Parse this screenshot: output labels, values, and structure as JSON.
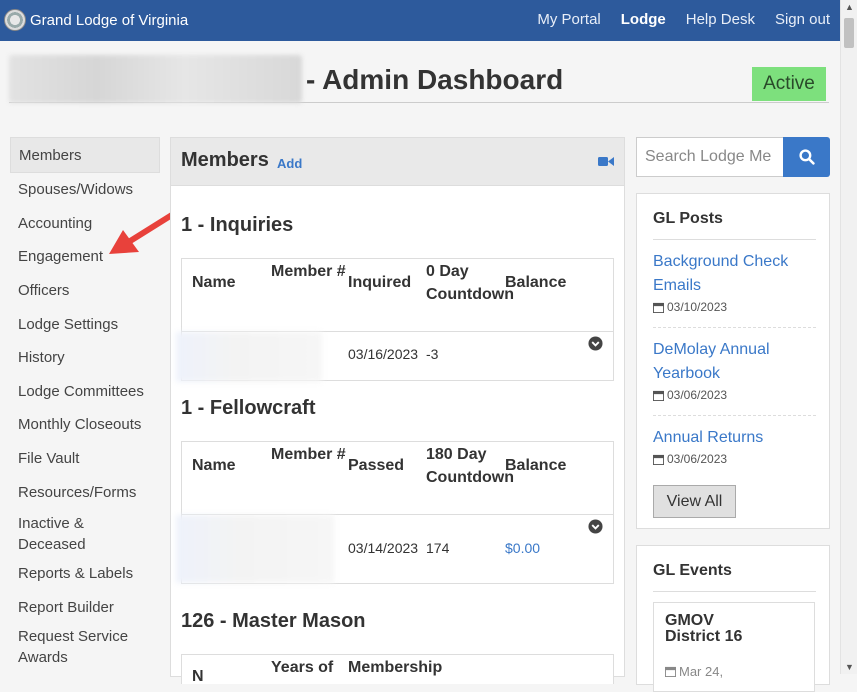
{
  "navbar": {
    "brand": "Grand Lodge of Virginia",
    "links": [
      "My Portal",
      "Lodge",
      "Help Desk",
      "Sign out"
    ]
  },
  "header": {
    "title": "- Admin Dashboard",
    "status": "Active"
  },
  "sidebar": {
    "items": [
      "Members",
      "Spouses/Widows",
      "Accounting",
      "Engagement",
      "Officers",
      "Lodge Settings",
      "History",
      "Lodge Committees",
      "Monthly Closeouts",
      "File Vault",
      "Resources/Forms",
      "Inactive & Deceased",
      "Reports & Labels",
      "Report Builder",
      "Request Service Awards"
    ]
  },
  "members": {
    "title": "Members",
    "add": "Add",
    "sections": [
      {
        "title": "1 - Inquiries",
        "headers": [
          "Name",
          "Member #",
          "Inquired",
          "0 Day Countdown",
          "Balance"
        ],
        "row": {
          "date": "03/16/2023",
          "countdown": "-3",
          "balance": ""
        }
      },
      {
        "title": "1 - Fellowcraft",
        "headers": [
          "Name",
          "Member #",
          "Passed",
          "180 Day Countdown",
          "Balance"
        ],
        "row": {
          "date": "03/14/2023",
          "countdown": "174",
          "balance": "$0.00"
        }
      },
      {
        "title": "126 - Master Mason",
        "headers": [
          "N",
          "Years of",
          "Membership"
        ]
      }
    ]
  },
  "search": {
    "placeholder": "Search Lodge Me"
  },
  "gl_posts": {
    "title": "GL Posts",
    "posts": [
      {
        "title": "Background Check Emails",
        "date": "03/10/2023"
      },
      {
        "title": "DeMolay Annual Yearbook",
        "date": "03/06/2023"
      },
      {
        "title": "Annual Returns",
        "date": "03/06/2023"
      }
    ],
    "view_all": "View All"
  },
  "gl_events": {
    "title": "GL Events",
    "events": [
      {
        "title": "GMOV District 16",
        "date": "Mar 24,"
      }
    ]
  },
  "colors": {
    "navbar": "#2d5a9c",
    "link": "#3a78c8",
    "active": "#7de07d",
    "arrow": "#e8413b"
  }
}
